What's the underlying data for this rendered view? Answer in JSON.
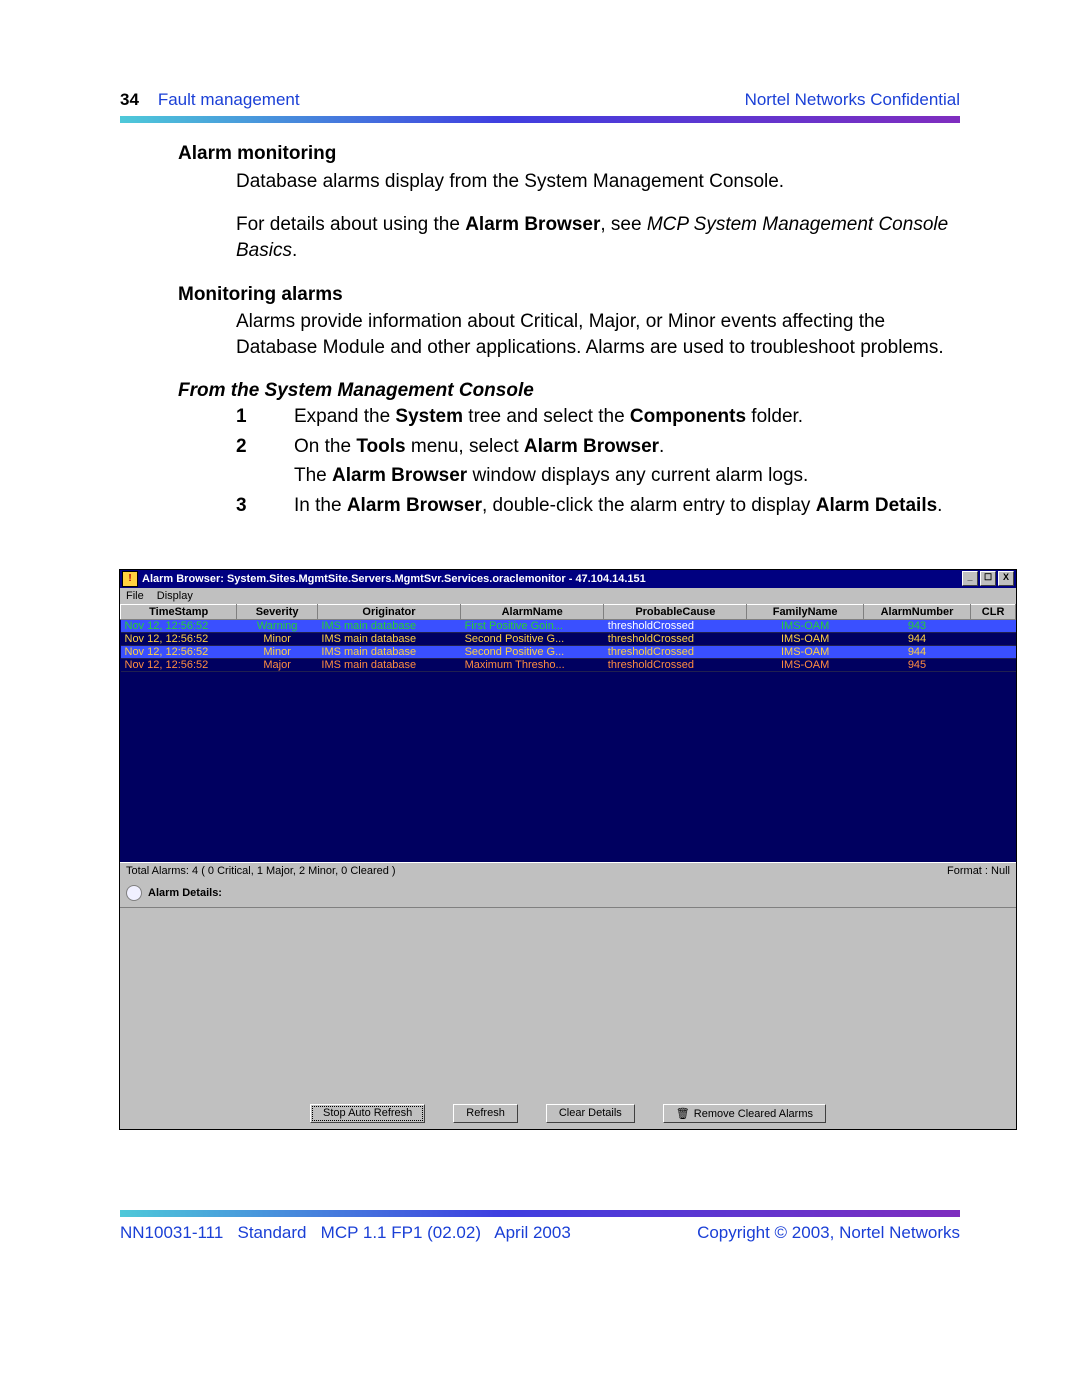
{
  "header": {
    "page_number": "34",
    "section": "Fault management",
    "confidential": "Nortel Networks Confidential"
  },
  "body": {
    "h_alarm_monitoring": "Alarm monitoring",
    "p_db_alarms": "Database alarms display from the System Management Console.",
    "p_details_pre": "For details about using the ",
    "p_details_bold": "Alarm Browser",
    "p_details_mid": ", see ",
    "p_details_italic": "MCP System Management Console Basics",
    "p_details_end": ".",
    "h_monitoring_alarms": "Monitoring alarms",
    "p_alarms_info": "Alarms provide information about Critical, Major, or Minor events affecting the Database Module and other applications. Alarms are used to troubleshoot problems.",
    "h_from_smc": "From the System Management Console",
    "steps": {
      "s1_num": "1",
      "s1_a": "Expand the ",
      "s1_b": "System",
      "s1_c": " tree and select the ",
      "s1_d": "Components",
      "s1_e": " folder.",
      "s2_num": "2",
      "s2_a": "On the ",
      "s2_b": "Tools",
      "s2_c": " menu, select ",
      "s2_d": "Alarm Browser",
      "s2_e": ".",
      "s2_sub_a": "The ",
      "s2_sub_b": "Alarm Browser",
      "s2_sub_c": " window displays any current alarm logs.",
      "s3_num": "3",
      "s3_a": "In the ",
      "s3_b": "Alarm Browser",
      "s3_c": ", double-click the alarm entry to display ",
      "s3_d": "Alarm Details",
      "s3_e": "."
    }
  },
  "window": {
    "title": "Alarm Browser: System.Sites.MgmtSite.Servers.MgmtSvr.Services.oraclemonitor - 47.104.14.151",
    "icon_glyph": "!",
    "min_btn": "_",
    "max_btn": "☐",
    "close_btn": "X",
    "menu_file": "File",
    "menu_display": "Display",
    "columns": {
      "c0": "TimeStamp",
      "c1": "Severity",
      "c2": "Originator",
      "c3": "AlarmName",
      "c4": "ProbableCause",
      "c5": "FamilyName",
      "c6": "AlarmNumber",
      "c7": "CLR"
    },
    "rows": [
      {
        "ts": "Nov 12, 12:56:52",
        "sv": "Warning",
        "og": "IMS main database",
        "an": "First Positive Goin...",
        "pc": "thresholdCrossed",
        "fn": "IMS-OAM",
        "nm": "943",
        "clr": "",
        "cls": "warning selected"
      },
      {
        "ts": "Nov 12, 12:56:52",
        "sv": "Minor",
        "og": "IMS main database",
        "an": "Second Positive G...",
        "pc": "thresholdCrossed",
        "fn": "IMS-OAM",
        "nm": "944",
        "clr": "",
        "cls": "minor"
      },
      {
        "ts": "Nov 12, 12:56:52",
        "sv": "Minor",
        "og": "IMS main database",
        "an": "Second Positive G...",
        "pc": "thresholdCrossed",
        "fn": "IMS-OAM",
        "nm": "944",
        "clr": "",
        "cls": "minor selected"
      },
      {
        "ts": "Nov 12, 12:56:52",
        "sv": "Major",
        "og": "IMS main database",
        "an": "Maximum Thresho...",
        "pc": "thresholdCrossed",
        "fn": "IMS-OAM",
        "nm": "945",
        "clr": "",
        "cls": "major"
      }
    ],
    "status_left": "Total Alarms: 4 ( 0 Critical, 1 Major, 2 Minor, 0 Cleared )",
    "status_right": "Format : Null",
    "details_label": "Alarm Details:",
    "btn_stop": "Stop Auto Refresh",
    "btn_refresh": "Refresh",
    "btn_clear": "Clear Details",
    "btn_remove": "Remove Cleared Alarms",
    "trash_glyph": "🗑"
  },
  "footer": {
    "docnum": "NN10031-111",
    "standard": "Standard",
    "version": "MCP 1.1 FP1 (02.02)",
    "date": "April 2003",
    "copyright": "Copyright © 2003, Nortel Networks"
  }
}
